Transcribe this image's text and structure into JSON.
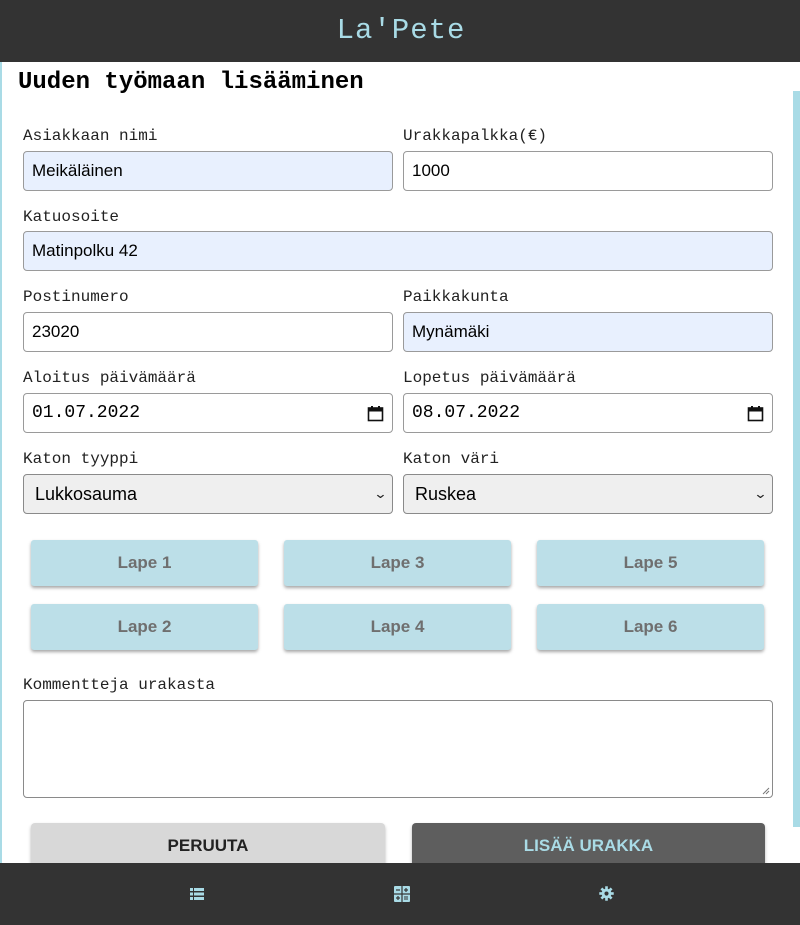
{
  "header": {
    "title": "La'Pete"
  },
  "form": {
    "title": "Uuden työmaan lisääminen",
    "customer_name": {
      "label": "Asiakkaan nimi",
      "value": "Meikäläinen"
    },
    "price": {
      "label": "Urakkapalkka(€)",
      "value": "1000"
    },
    "street": {
      "label": "Katuosoite",
      "value": "Matinpolku 42"
    },
    "postal_code": {
      "label": "Postinumero",
      "value": "23020"
    },
    "city": {
      "label": "Paikkakunta",
      "value": "Mynämäki"
    },
    "start_date": {
      "label": "Aloitus päivämäärä",
      "value": "01.07.2022"
    },
    "end_date": {
      "label": "Lopetus päivämäärä",
      "value": "08.07.2022"
    },
    "roof_type": {
      "label": "Katon tyyppi",
      "selected": "Lukkosauma"
    },
    "roof_color": {
      "label": "Katon väri",
      "selected": "Ruskea"
    },
    "lapes": [
      "Lape 1",
      "Lape 3",
      "Lape 5",
      "Lape 2",
      "Lape 4",
      "Lape 6"
    ],
    "comments": {
      "label": "Kommentteja urakasta",
      "value": ""
    },
    "cancel_label": "PERUUTA",
    "submit_label": "LISÄÄ URAKKA"
  },
  "nav": {
    "icons": [
      "list-icon",
      "calculator-icon",
      "gear-icon"
    ]
  },
  "colors": {
    "bar": "#333333",
    "accent": "#a9dbe6",
    "lape_button": "#bcdfe8",
    "autofill": "#e8f0fe"
  }
}
